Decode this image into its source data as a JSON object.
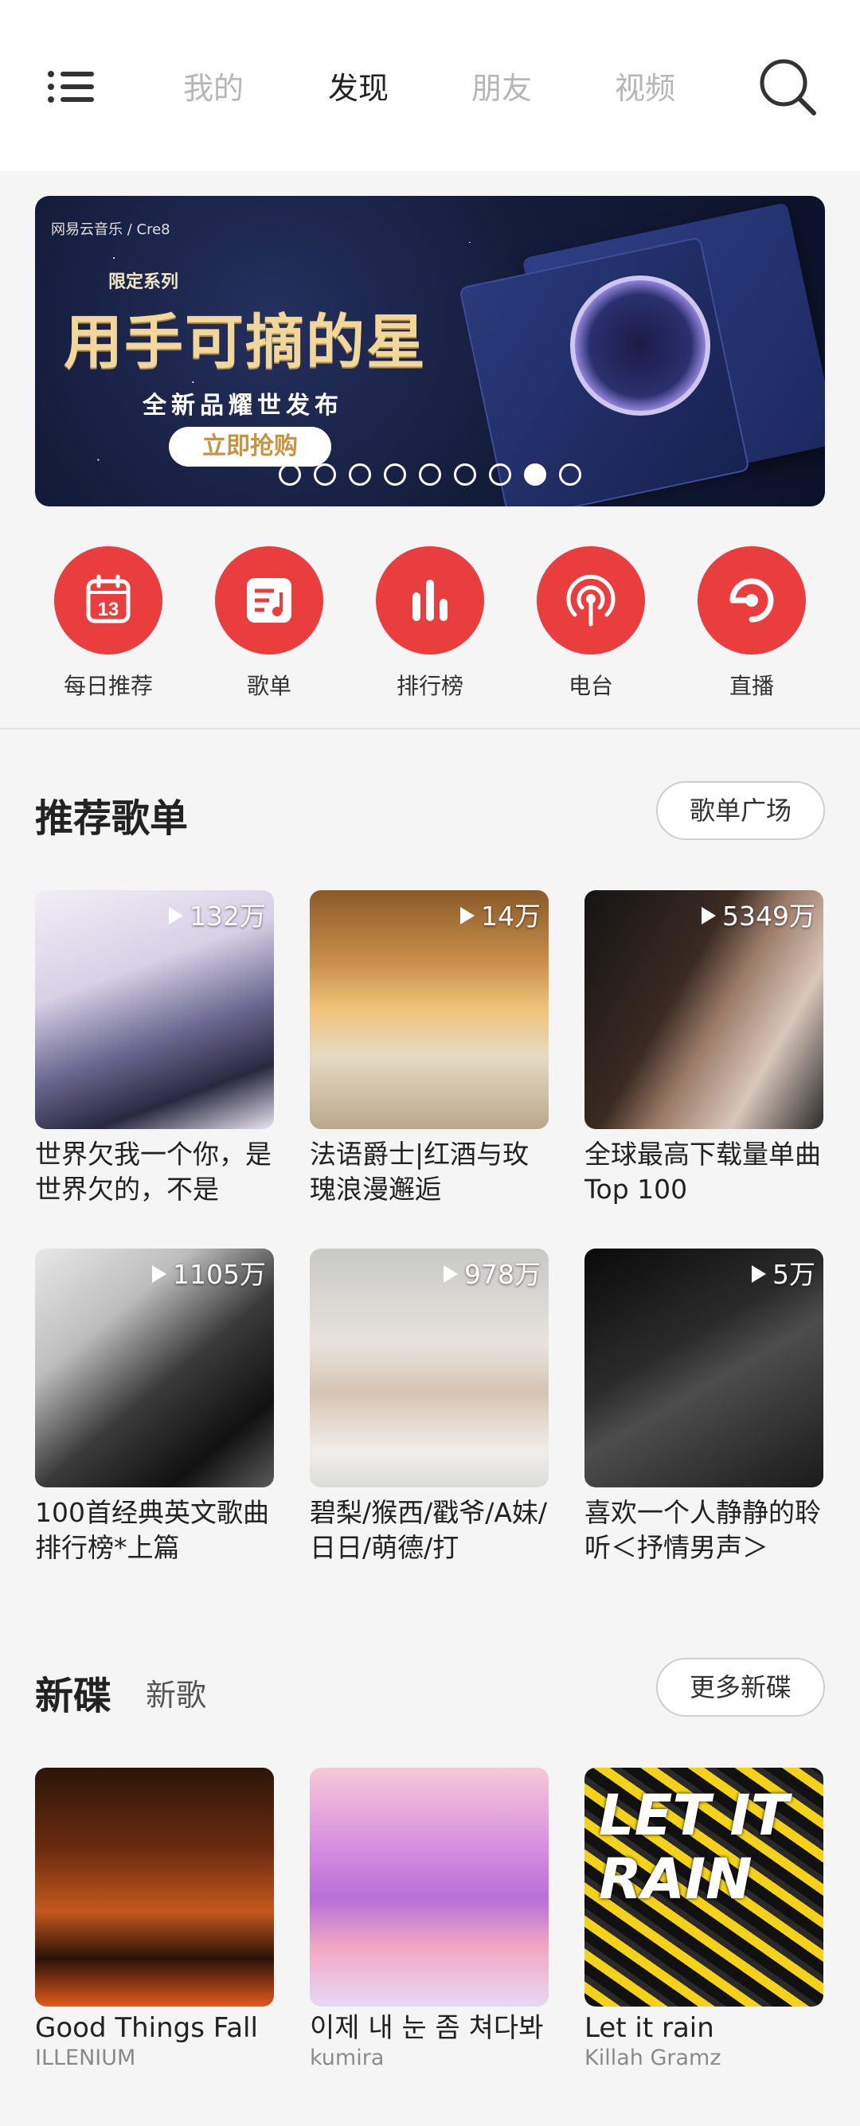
{
  "header": {
    "tabs": [
      "我的",
      "发现",
      "朋友",
      "视频"
    ],
    "active_tab": "发现"
  },
  "banner": {
    "brand": "网易云音乐 / Cre8",
    "series": "限定系列",
    "headline": "用手可摘的星",
    "subtitle": "全新品耀世发布",
    "cta": "立即抢购",
    "page_count": 9,
    "active_page": 8
  },
  "shortcuts": [
    {
      "label": "每日推荐",
      "icon": "calendar-icon"
    },
    {
      "label": "歌单",
      "icon": "playlist-icon"
    },
    {
      "label": "排行榜",
      "icon": "chart-bars-icon"
    },
    {
      "label": "电台",
      "icon": "radio-icon"
    },
    {
      "label": "直播",
      "icon": "live-icon"
    }
  ],
  "recommended": {
    "title": "推荐歌单",
    "more_label": "歌单广场",
    "playlists": [
      {
        "plays": "132万",
        "title": "世界欠我一个你，是世界欠的，不是"
      },
      {
        "plays": "14万",
        "title": "法语爵士|红酒与玫瑰浪漫邂逅"
      },
      {
        "plays": "5349万",
        "title": "全球最高下载量单曲Top 100"
      },
      {
        "plays": "1105万",
        "title": "100首经典英文歌曲排行榜*上篇"
      },
      {
        "plays": "978万",
        "title": "碧梨/猴西/戳爷/A妹/日日/萌德/打"
      },
      {
        "plays": "5万",
        "title": "喜欢一个人静静的聆听＜抒情男声＞"
      }
    ]
  },
  "new_releases": {
    "title": "新碟",
    "tab2": "新歌",
    "more_label": "更多新碟",
    "albums": [
      {
        "title": "Good Things Fall",
        "artist": "ILLENIUM"
      },
      {
        "title": "이제 내 눈 좀 쳐다봐",
        "artist": "kumira"
      },
      {
        "title": "Let it rain",
        "artist": "Killah Gramz",
        "cover_text": "LET IT RAIN"
      }
    ]
  },
  "colors": {
    "accent_red": "#ea3d3d",
    "background": "#f5f5f6"
  }
}
